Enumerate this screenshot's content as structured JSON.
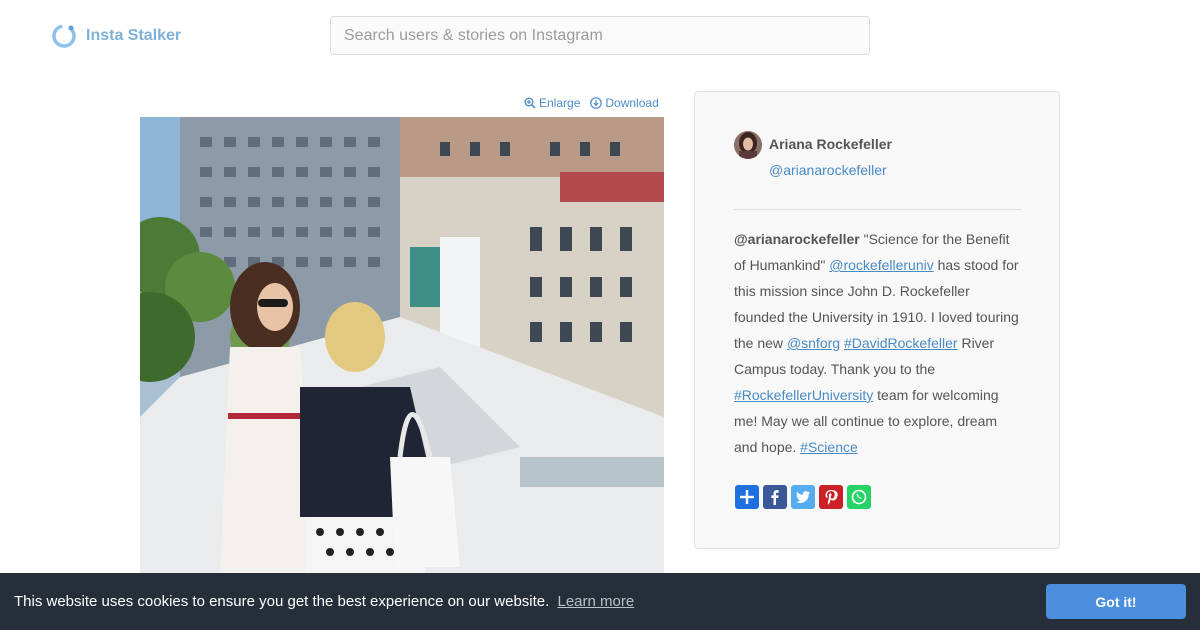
{
  "header": {
    "logo_text": "Insta Stalker",
    "logo_icon": "ring-logo-icon",
    "search_placeholder": "Search users & stories on Instagram"
  },
  "media": {
    "enlarge_label": "Enlarge",
    "download_label": "Download",
    "enlarge_icon": "zoom-in-icon",
    "download_icon": "download-circle-icon"
  },
  "profile": {
    "display_name": "Ariana Rockefeller",
    "handle": "@arianarockefeller"
  },
  "caption": {
    "author_prefix": "@",
    "author": "arianarockefeller",
    "text_1": " \"Science for the Benefit of Humankind\" ",
    "link_1": "@rockefelleruniv",
    "text_2": " has stood for this mission since John D. Rockefeller founded the University in 1910. I loved touring the new ",
    "link_2": "@snforg",
    "text_3": " ",
    "link_3": "#DavidRockefeller",
    "text_4": " River Campus today. Thank you to the ",
    "link_4": "#RockefellerUniversity",
    "text_5": " team for welcoming me! May we all continue to explore, dream and hope. ",
    "link_5": "#Science"
  },
  "share": {
    "buttons": [
      {
        "icon": "plus-share-icon",
        "color": "#1e6fe0"
      },
      {
        "icon": "facebook-icon",
        "color": "#3b5998"
      },
      {
        "icon": "twitter-icon",
        "color": "#55acee"
      },
      {
        "icon": "pinterest-icon",
        "color": "#cb2027"
      },
      {
        "icon": "whatsapp-icon",
        "color": "#25d366"
      }
    ]
  },
  "cookie": {
    "message": "This website uses cookies to ensure you get the best experience on our website.",
    "learn_more": "Learn more",
    "button": "Got it!"
  },
  "colors": {
    "accent": "#4a8bc5",
    "logo": "#7fb0d8",
    "cookie_bg": "#252e39",
    "cookie_button": "#4b8ede"
  }
}
